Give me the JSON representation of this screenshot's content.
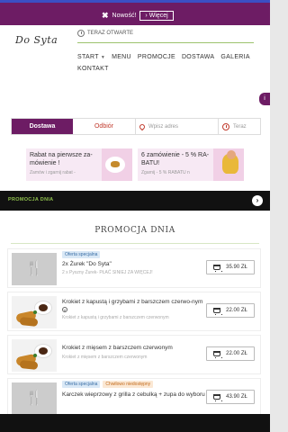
{
  "topbar": {
    "close_symbol": "✖",
    "new_label": "Nowość!",
    "more_label": "Więcej",
    "more_chevron": "›"
  },
  "header": {
    "logo": "Do Syta",
    "status": "TERAZ OTWARTE",
    "nav": [
      {
        "label": "START",
        "dropdown": true
      },
      {
        "label": "MENU",
        "dropdown": false
      },
      {
        "label": "PROMOCJE",
        "dropdown": false
      },
      {
        "label": "DOSTAWA",
        "dropdown": false
      },
      {
        "label": "GALERIA",
        "dropdown": false
      },
      {
        "label": "KONTAKT",
        "dropdown": false
      }
    ],
    "caret": "▼"
  },
  "side_badge": "i",
  "order": {
    "delivery_tab": "Dostawa",
    "pickup_tab": "Odbiór",
    "address_placeholder": "Wpisz adres",
    "time_label": "Teraz"
  },
  "promos": [
    {
      "title": "Rabat na pierwsze za-mówienie !",
      "subtitle": "Zamów i zgarnij rabat -"
    },
    {
      "title": "6 zamówienie - 5 % RA-BATU!",
      "subtitle": "Zgarnij - 5 % RABATU n"
    }
  ],
  "dark_banner": {
    "label": "PROMOCJA DNIA",
    "arrow": "›"
  },
  "section_title": "PROMOCJA DNIA",
  "items": [
    {
      "badges": [
        "Oferta specjalna"
      ],
      "title": "Żurek \"Do Syta\"",
      "qty_prefix": "2x",
      "description": "2 x Pyszny Żurek- PŁAĆ SINIEJ ZA WIĘCEJ!",
      "price": "35.90 ZŁ"
    },
    {
      "badges": [],
      "title": "Krokiet z kapustą i grzybami z barszczem czerwo-nym",
      "veg_symbol": "V",
      "description": "Krokiet z kapustą i grzybami z barszczem czerwonym",
      "price": "22.00 ZŁ"
    },
    {
      "badges": [],
      "title": "Krokiet z mięsem z barszczem czerwonym",
      "description": "Krokiet z mięsem z barszczem czerwonym",
      "price": "22.00 ZŁ"
    },
    {
      "badges": [
        "Oferta specjalna",
        "Chwilowo niedostępny"
      ],
      "title": "Karczek wieprzowy z grilla z cebulką + zupa do wyboru",
      "description": "",
      "price": "43.90 ZŁ"
    }
  ],
  "icons": {
    "cutlery": "🍴",
    "cart": "cart-icon"
  },
  "colors": {
    "brand": "#6d1c64",
    "accent_green": "#8fc04d",
    "red": "#c0392b"
  }
}
